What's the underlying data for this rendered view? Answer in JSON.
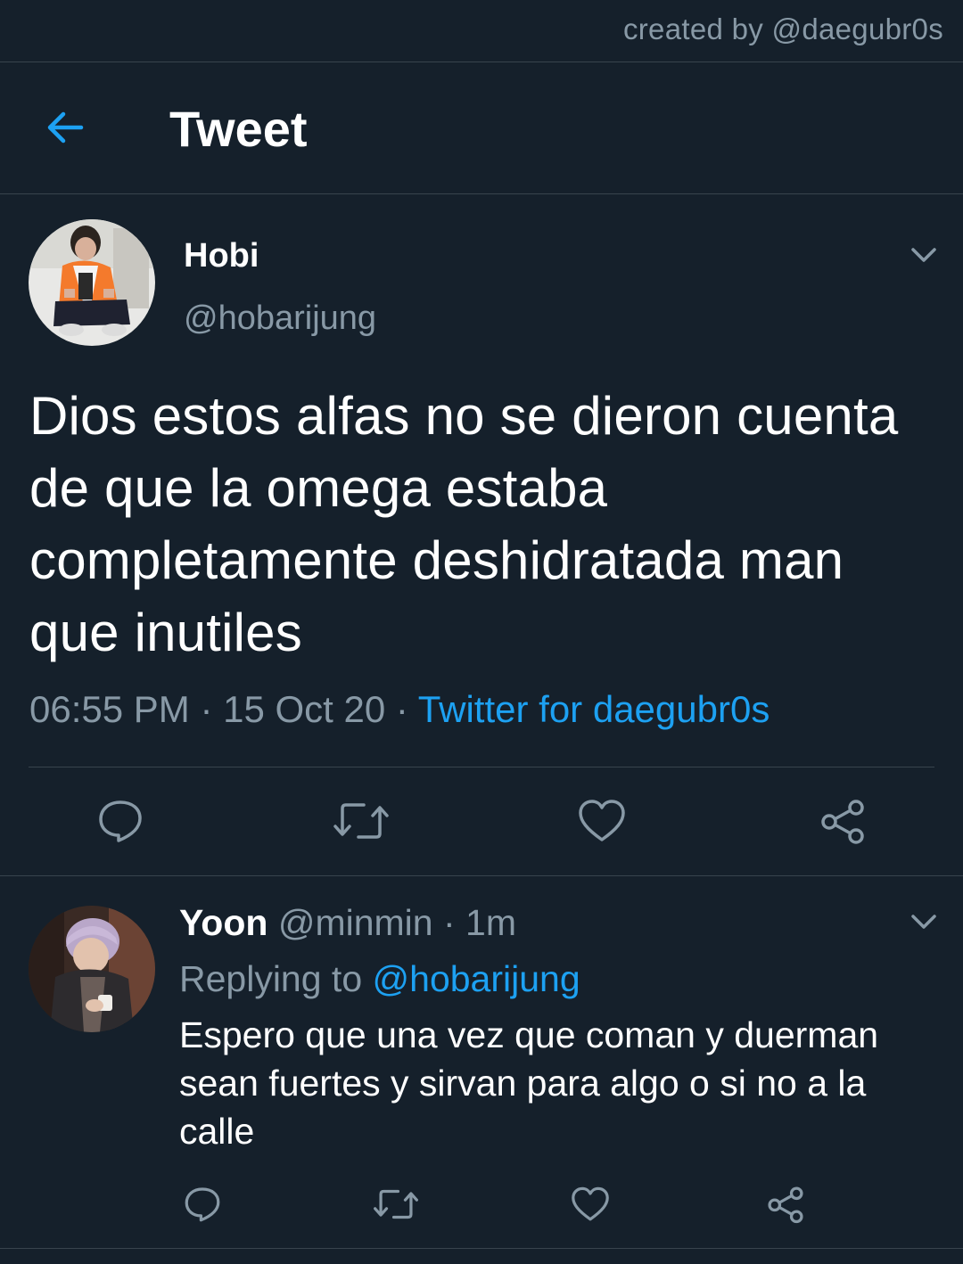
{
  "watermark": "created by @daegubr0s",
  "header": {
    "title": "Tweet"
  },
  "main_tweet": {
    "name": "Hobi",
    "handle": "@hobarijung",
    "text": "Dios estos alfas no se dieron cuenta de que la omega estaba completamente deshidratada man que inutiles",
    "time": "06:55 PM",
    "sep": " · ",
    "date": "15 Oct 20",
    "source": "Twitter for daegubr0s"
  },
  "reply_tweet": {
    "name": "Yoon",
    "handle": "@minmin",
    "sep": " · ",
    "time": "1m",
    "replying_prefix": "Replying to ",
    "replying_to": "@hobarijung",
    "text": "Espero que una vez que coman y duerman sean fuertes y sirvan para algo o si no a la calle"
  },
  "icons": {
    "back": "arrow-left-icon",
    "menu": "chevron-down-icon",
    "reply": "reply-bubble-icon",
    "retweet": "retweet-icon",
    "like": "heart-icon",
    "share": "share-icon"
  },
  "colors": {
    "background": "#15202b",
    "accent": "#1da1f2",
    "secondary_text": "#8899a6",
    "divider": "#38444d"
  }
}
